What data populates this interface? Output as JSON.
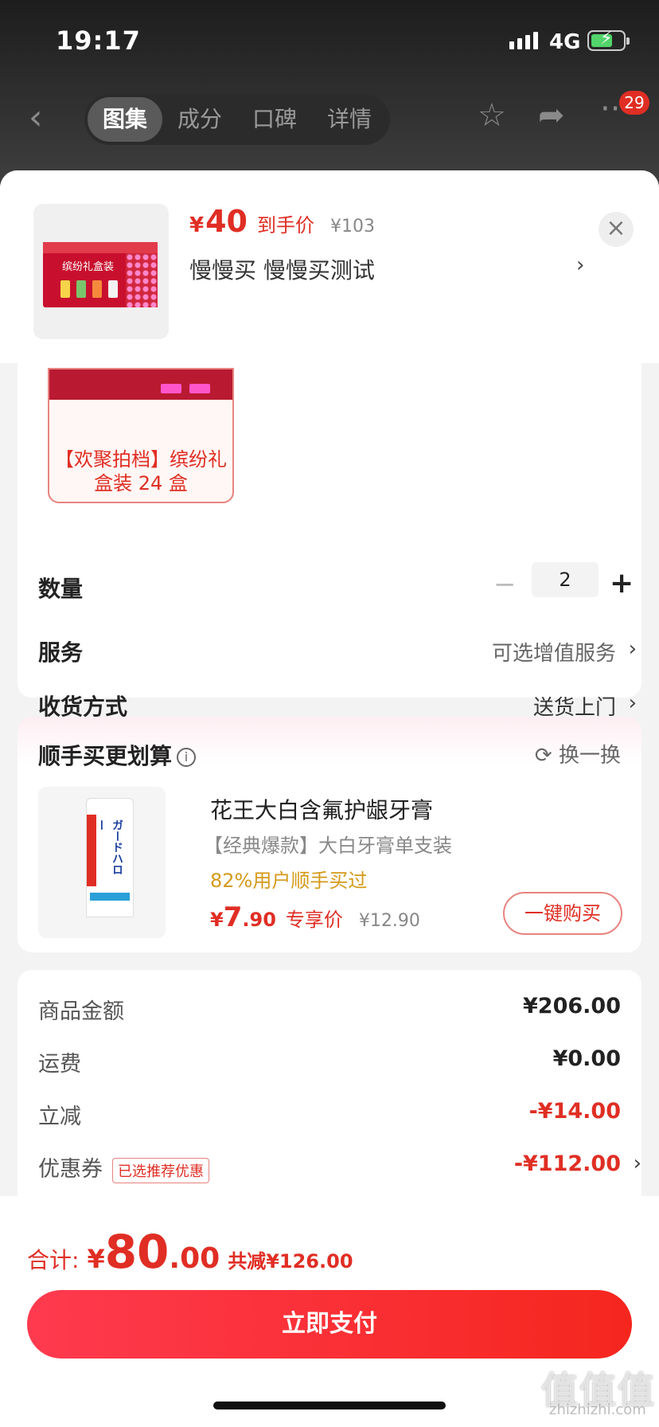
{
  "status": {
    "time": "19:17",
    "network": "4G"
  },
  "nav": {
    "tabs": [
      "图集",
      "成分",
      "口碑",
      "详情"
    ],
    "active_tab": 0,
    "badge": "29"
  },
  "product": {
    "price_symbol": "¥",
    "price": "40",
    "price_label": "到手价",
    "original_price": "¥103",
    "shop": "慢慢买  慢慢买测试"
  },
  "sku": {
    "name": "【欢聚拍档】缤纷礼盒装 24 盒"
  },
  "options": {
    "quantity_label": "数量",
    "quantity": "2",
    "service_label": "服务",
    "service_value": "可选增值服务",
    "delivery_label": "收货方式",
    "delivery_value": "送货上门"
  },
  "addon": {
    "title": "顺手买更划算",
    "swap": "换一换",
    "name": "花王大白含氟护龈牙膏",
    "subtitle": "【经典爆款】大白牙膏单支装",
    "buy_rate": "82%用户顺手买过",
    "price_symbol": "¥",
    "price_int": "7",
    "price_dec": ".90",
    "price_label": "专享价",
    "original_price": "¥12.90",
    "buy_button": "一键购买"
  },
  "summary": {
    "goods_label": "商品金额",
    "goods_value": "¥206.00",
    "shipping_label": "运费",
    "shipping_value": "¥0.00",
    "discount_label": "立减",
    "discount_value": "-¥14.00",
    "coupon_label": "优惠券",
    "coupon_tag": "已选推荐优惠",
    "coupon_value": "-¥112.00"
  },
  "footer": {
    "total_label": "合计:",
    "total_symbol": "¥",
    "total_int": "80",
    "total_dec": ".00",
    "total_saved": "共减¥126.00",
    "pay_button": "立即支付"
  },
  "watermark": {
    "logo": "值值值",
    "site": "zhizhizhi.com"
  },
  "colors": {
    "accent": "#e02e24",
    "addon_rate": "#d49a1a"
  }
}
